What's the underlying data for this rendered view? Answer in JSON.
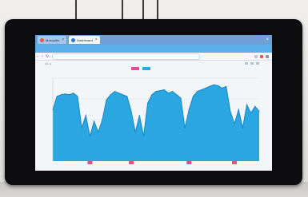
{
  "scene": {
    "description_free": true
  },
  "browser": {
    "tabs": [
      {
        "label": "Mosquitto",
        "icon": "red-dot",
        "active": false
      },
      {
        "label": "Dashboard",
        "icon": "blue-dot",
        "active": true
      }
    ],
    "new_tab_symbol": "×",
    "page_header": "",
    "url": "",
    "nav": {
      "back": "‹",
      "forward": "›",
      "reload": "↻"
    }
  },
  "colors": {
    "fill_primary": "#2aa6e0",
    "fill_dark": "#1b86c2",
    "accent_pink": "#e84a9a",
    "tab_bar": "#6f9fd6",
    "header": "#5ab0e8"
  },
  "legend": {
    "items": [
      {
        "color": "#e84a9a"
      },
      {
        "color": "#2aa6e0"
      }
    ]
  },
  "chart_data": {
    "type": "area",
    "title": "",
    "xlabel": "",
    "ylabel": "",
    "ylim": [
      0,
      100
    ],
    "x": [
      0,
      2,
      4,
      6,
      8,
      10,
      12,
      14,
      16,
      18,
      20,
      22,
      24,
      26,
      28,
      30,
      32,
      34,
      36,
      38,
      40,
      42,
      44,
      46,
      48,
      50,
      52,
      54,
      56,
      58,
      60,
      62,
      64,
      66,
      68,
      70,
      72,
      74,
      76,
      78,
      80,
      82,
      84,
      86,
      88,
      90,
      92,
      94,
      96,
      98,
      100
    ],
    "series": [
      {
        "values": [
          62,
          78,
          80,
          81,
          80,
          82,
          78,
          40,
          55,
          30,
          48,
          35,
          50,
          74,
          80,
          84,
          82,
          80,
          78,
          60,
          35,
          55,
          30,
          70,
          80,
          84,
          85,
          86,
          82,
          84,
          80,
          76,
          40,
          62,
          78,
          84,
          86,
          88,
          90,
          92,
          91,
          88,
          90,
          60,
          45,
          62,
          40,
          68,
          58,
          66,
          60
        ]
      }
    ],
    "markers": {
      "color": "#e84a9a",
      "x": [
        18,
        38,
        66,
        88
      ]
    }
  }
}
